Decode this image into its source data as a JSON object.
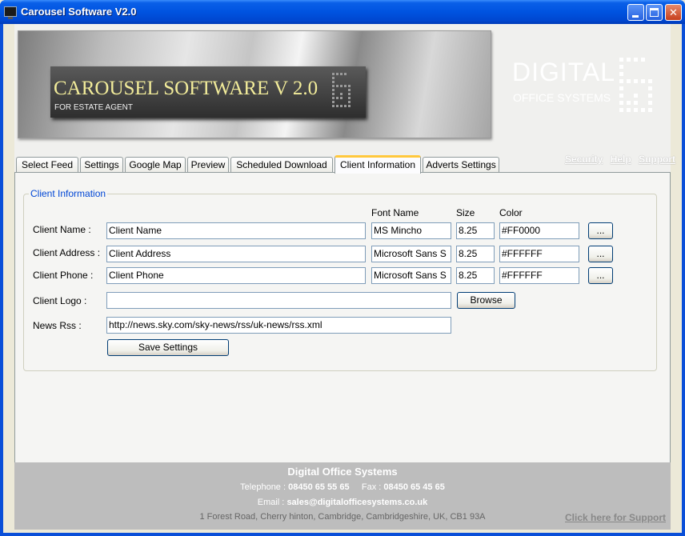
{
  "window": {
    "title": "Carousel Software V2.0"
  },
  "banner": {
    "title": "CAROUSEL SOFTWARE V 2.0",
    "subtitle": "FOR ESTATE AGENT",
    "brand_line1": "DIGITAL",
    "brand_line2": "OFFICE SYSTEMS"
  },
  "tabs": [
    {
      "label": "Select Feed"
    },
    {
      "label": "Settings"
    },
    {
      "label": "Google Map"
    },
    {
      "label": "Preview"
    },
    {
      "label": "Scheduled Download"
    },
    {
      "label": "Client Information",
      "active": true
    },
    {
      "label": "Adverts Settings"
    }
  ],
  "top_links": {
    "security": "Security",
    "help": "Help",
    "support": "Support"
  },
  "client_info": {
    "group_title": "Client Information",
    "col_font": "Font Name",
    "col_size": "Size",
    "col_color": "Color",
    "rows": [
      {
        "label": "Client Name :",
        "value": "Client Name",
        "font": "MS Mincho",
        "size": "8.25",
        "color": "#FF0000",
        "picker": "..."
      },
      {
        "label": "Client Address :",
        "value": "Client Address",
        "font": "Microsoft Sans S",
        "size": "8.25",
        "color": "#FFFFFF",
        "picker": "..."
      },
      {
        "label": "Client Phone :",
        "value": "Client Phone",
        "font": "Microsoft Sans S",
        "size": "8.25",
        "color": "#FFFFFF",
        "picker": "..."
      }
    ],
    "logo_label": "Client Logo :",
    "logo_value": "",
    "browse_label": "Browse",
    "rss_label": "News Rss :",
    "rss_value": "http://news.sky.com/sky-news/rss/uk-news/rss.xml",
    "save_label": "Save Settings"
  },
  "footer": {
    "company": "Digital Office Systems",
    "telephone_label": "Telephone :",
    "telephone": "08450 65 55 65",
    "fax_label": "Fax :",
    "fax": "08450 65 45 65",
    "email_label": "Email :",
    "email": "sales@digitalofficesystems.co.uk",
    "address": "1 Forest Road, Cherry hinton, Cambridge, Cambridgeshire, UK, CB1 93A",
    "support_link": "Click here for Support"
  },
  "colors": {
    "titlebar": "#0053e0",
    "active_tab_accent": "#ffc83c",
    "group_title": "#0046d5",
    "footer_bg": "#bdbdbd"
  }
}
